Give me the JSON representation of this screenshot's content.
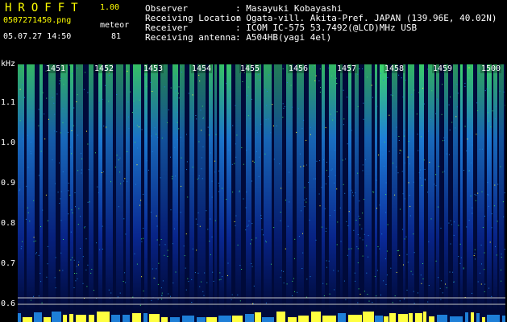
{
  "app": {
    "title": "HROFFT",
    "version": "1.00"
  },
  "capture": {
    "file_name": "0507271450.png",
    "datetime": "05.07.27 14:50",
    "mode_label": "meteor",
    "count": "81"
  },
  "station": [
    {
      "label": "Observer",
      "value": ": Masayuki Kobayashi"
    },
    {
      "label": "Receiving Location",
      "value": ": Ogata-vill. Akita-Pref. JAPAN (139.96E, 40.02N)"
    },
    {
      "label": "Receiver",
      "value": ": ICOM IC-575 53.7492(@LCD)MHz USB"
    },
    {
      "label": "Receiving antenna",
      "value": ": A504HB(yagi 4el)"
    }
  ],
  "spectrogram": {
    "unit": "kHz",
    "y_ticks": [
      "1.1",
      "1.0",
      "0.9",
      "0.8",
      "0.7",
      "0.6"
    ],
    "x_ticks": [
      "1451",
      "1452",
      "1453",
      "1454",
      "1455",
      "1456",
      "1457",
      "1458",
      "1459",
      "1500"
    ],
    "colors": {
      "background": "#000a3a",
      "low": "#0a2a9a",
      "mid": "#1e7fd8",
      "high": "#3cd46a",
      "peak": "#ffff40"
    }
  }
}
